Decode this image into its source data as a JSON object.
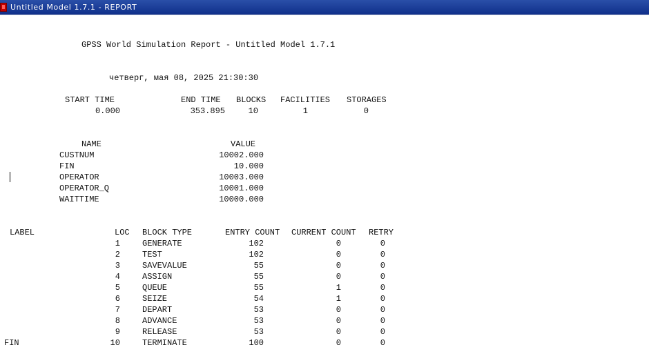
{
  "window": {
    "title": "Untitled Model 1.7.1 - REPORT"
  },
  "report": {
    "heading": "GPSS World Simulation Report - Untitled Model 1.7.1",
    "datetime": "четверг, мая 08, 2025 21:30:30",
    "summary": {
      "headers": [
        "START TIME",
        "END TIME",
        "BLOCKS",
        "FACILITIES",
        "STORAGES"
      ],
      "values": [
        "0.000",
        "353.895",
        "10",
        "1",
        "0"
      ]
    },
    "names": {
      "headers": [
        "NAME",
        "VALUE"
      ],
      "rows": [
        [
          "CUSTNUM",
          "10002.000"
        ],
        [
          "FIN",
          "10.000"
        ],
        [
          "OPERATOR",
          "10003.000"
        ],
        [
          "OPERATOR_Q",
          "10001.000"
        ],
        [
          "WAITTIME",
          "10000.000"
        ]
      ]
    },
    "blocks": {
      "headers": [
        "LABEL",
        "LOC",
        "BLOCK TYPE",
        "ENTRY COUNT",
        "CURRENT COUNT",
        "RETRY"
      ],
      "rows": [
        [
          "",
          "1",
          "GENERATE",
          "102",
          "0",
          "0"
        ],
        [
          "",
          "2",
          "TEST",
          "102",
          "0",
          "0"
        ],
        [
          "",
          "3",
          "SAVEVALUE",
          "55",
          "0",
          "0"
        ],
        [
          "",
          "4",
          "ASSIGN",
          "55",
          "0",
          "0"
        ],
        [
          "",
          "5",
          "QUEUE",
          "55",
          "1",
          "0"
        ],
        [
          "",
          "6",
          "SEIZE",
          "54",
          "1",
          "0"
        ],
        [
          "",
          "7",
          "DEPART",
          "53",
          "0",
          "0"
        ],
        [
          "",
          "8",
          "ADVANCE",
          "53",
          "0",
          "0"
        ],
        [
          "",
          "9",
          "RELEASE",
          "53",
          "0",
          "0"
        ],
        [
          "FIN",
          "10",
          "TERMINATE",
          "100",
          "0",
          "0"
        ]
      ]
    }
  }
}
